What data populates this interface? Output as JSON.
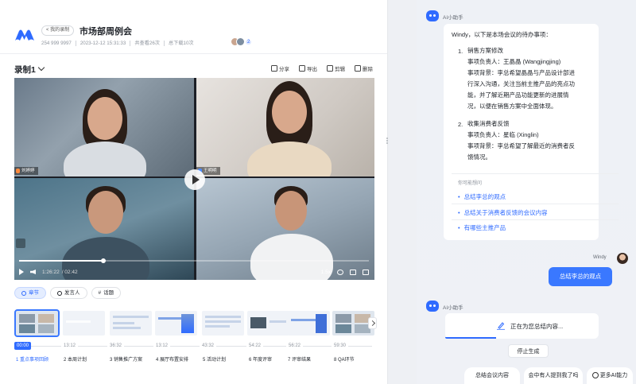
{
  "header": {
    "back_label": "< 我的录制",
    "title": "市场部周例会",
    "meeting_id": "254 999 9997",
    "datetime": "2023-12-12 15:31:33",
    "viewed": "共查看26次",
    "downloaded": "总下载10次",
    "avatar_count": "2"
  },
  "recording": {
    "title": "录制1",
    "toolbar": {
      "share": "分享",
      "export": "导出",
      "edit": "剪辑",
      "delete": "删除"
    }
  },
  "video": {
    "participants": [
      {
        "name": "刘婷婷"
      },
      {
        "name": "王明明"
      },
      {
        "name": ""
      },
      {
        "name": ""
      }
    ],
    "current_time": "1:26:22",
    "total_time": "/ 02:42",
    "speed": "1.5x",
    "progress": 0.24
  },
  "tabs": [
    {
      "label": "章节"
    },
    {
      "label": "发言人"
    },
    {
      "label": "话题"
    }
  ],
  "chapters": [
    {
      "time": "00:00",
      "label": "1 重点事项回顾"
    },
    {
      "time": "13:12",
      "label": "2 本周计划"
    },
    {
      "time": "36:32",
      "label": "3 销售推广方案"
    },
    {
      "time": "13:12",
      "label": "4 展厅布置安排"
    },
    {
      "time": "43:32",
      "label": "5 活动计划"
    },
    {
      "time": "54:22",
      "label": "6 年度评审"
    },
    {
      "time": "56:22",
      "label": "7 评审结果"
    },
    {
      "time": "59:30",
      "label": "8 QA环节"
    }
  ],
  "assistant": {
    "name": "AI小助手",
    "intro": "Windy，以下是本场会议的待办事项：",
    "todos": [
      {
        "num": "1.",
        "title": "销售方案修改",
        "owner": "事项负责人：王晶晶 (Wangjingjing)",
        "background_lines": [
          "事项背景：李总希望晶晶与产品设计部进",
          "行深入沟通，关注当前主推产品的亮点功",
          "能，并了解近期产品功能更新的进展情",
          "况，以便在销售方案中全面体现。"
        ]
      },
      {
        "num": "2.",
        "title": "收集消费者反馈",
        "owner": "事项负责人：星临 (Xinglin)",
        "background_lines": [
          "事项背景：李总希望了解最近的消费者反",
          "馈情况。"
        ]
      }
    ],
    "guess_title": "你可能想问",
    "guesses": [
      "总结李总的观点",
      "总结关于消费者反馈的会议内容",
      "有哪些主推产品"
    ],
    "status": "正在为您总结内容...",
    "stop_label": "停止生成"
  },
  "user": {
    "name": "Windy",
    "message": "总结李总的观点"
  },
  "quick_actions": [
    "总结会议内容",
    "会中有人提到我了吗",
    "更多AI能力"
  ],
  "colors": {
    "accent": "#2f6bff",
    "bubble": "#3a78ff"
  }
}
